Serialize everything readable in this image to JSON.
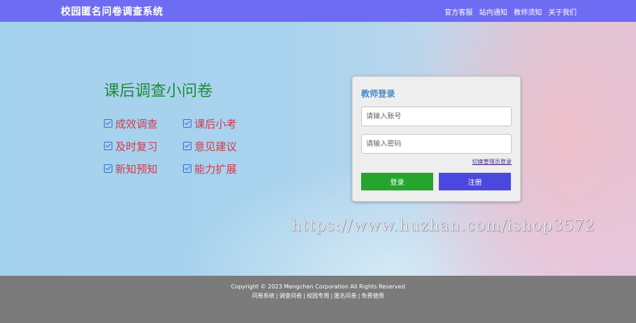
{
  "header": {
    "brand": "校园匿名问卷调查系统",
    "nav": [
      "官方客服",
      "站内通知",
      "教师须知",
      "关于我们"
    ]
  },
  "hero": {
    "slogan": "课后调查小问卷",
    "features": [
      "成效调查",
      "课后小考",
      "及时复习",
      "意见建议",
      "新知预知",
      "能力扩展"
    ]
  },
  "login": {
    "title": "教师登录",
    "account_placeholder": "请输入账号",
    "password_placeholder": "请输入密码",
    "switch_label": "切换管理员登录",
    "login_label": "登录",
    "register_label": "注册"
  },
  "watermark": "https://www.huzhan.com/ishop3572",
  "footer": {
    "copyright": "Copyright © 2023 Mengchen Corporation All Rights Reserved",
    "links": [
      "问卷系统",
      "调查问卷",
      "校园专用",
      "匿名问卷",
      "免费使用"
    ]
  },
  "colors": {
    "topbar": "#6e6cf3",
    "slogan": "#1f8b3a",
    "feature_text": "#d03a4c",
    "login_button": "#26a52e",
    "register_button": "#4b48e0",
    "footer": "#7b7b7b"
  }
}
